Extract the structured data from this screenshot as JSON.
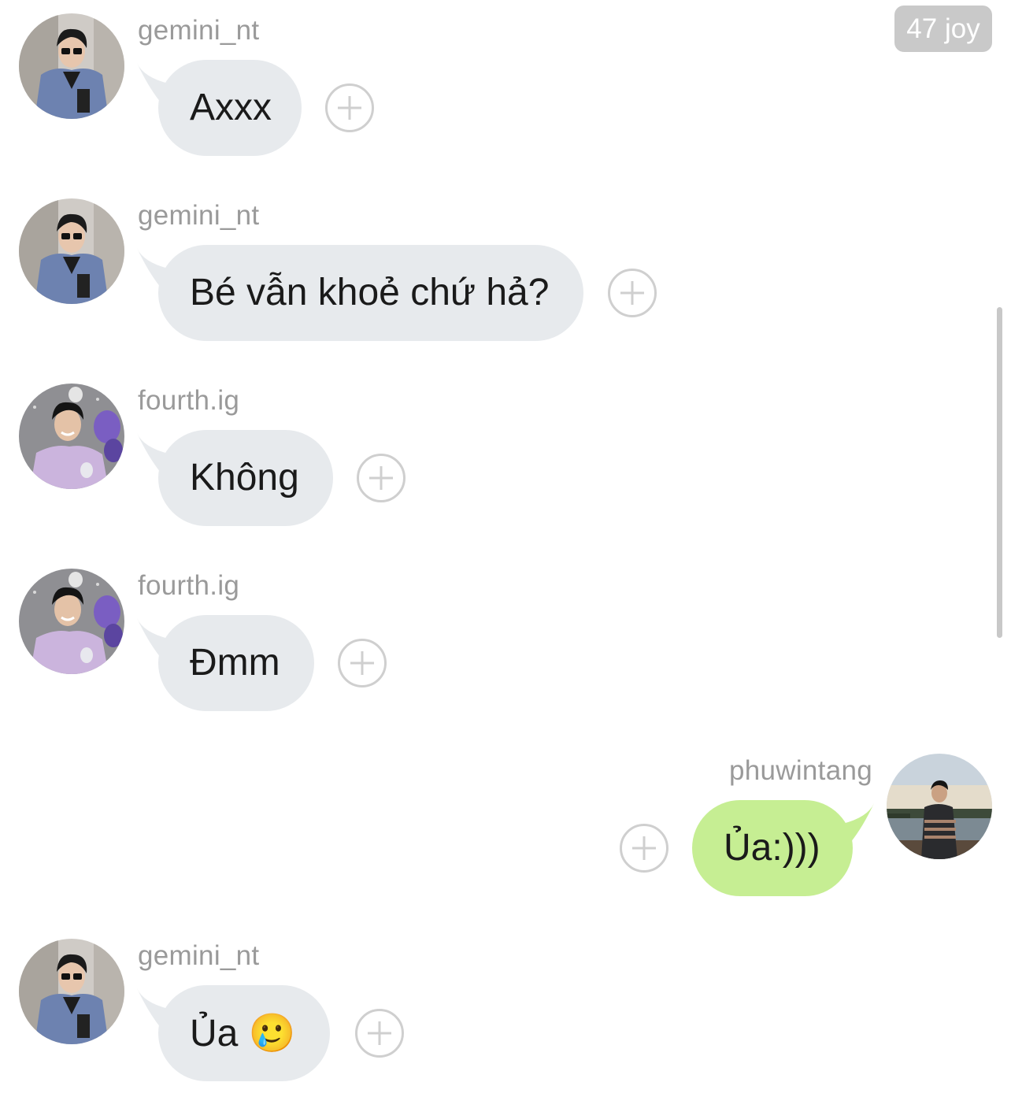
{
  "header": {
    "badge": "47 joy"
  },
  "messages": [
    {
      "sender": "gemini_nt",
      "text": "Axxx",
      "side": "left",
      "avatar": "gemini-avatar"
    },
    {
      "sender": "gemini_nt",
      "text": "Bé vẫn khoẻ chứ hả?",
      "side": "left",
      "avatar": "gemini-avatar"
    },
    {
      "sender": "fourth.ig",
      "text": "Không",
      "side": "left",
      "avatar": "fourth-avatar"
    },
    {
      "sender": "fourth.ig",
      "text": "Đmm",
      "side": "left",
      "avatar": "fourth-avatar"
    },
    {
      "sender": "phuwintang",
      "text": "Ủa:)))",
      "side": "right",
      "avatar": "phuwin-avatar"
    },
    {
      "sender": "gemini_nt",
      "text": "Ủa",
      "emoji": "🥲",
      "side": "left",
      "avatar": "gemini-avatar"
    }
  ],
  "colors": {
    "incoming_bubble": "#e7eaed",
    "outgoing_bubble": "#c6ee93",
    "sender_name": "#9a9a9a",
    "badge_bg": "#c9c9c9"
  },
  "icons": {
    "reaction": "plus-circle-icon"
  }
}
